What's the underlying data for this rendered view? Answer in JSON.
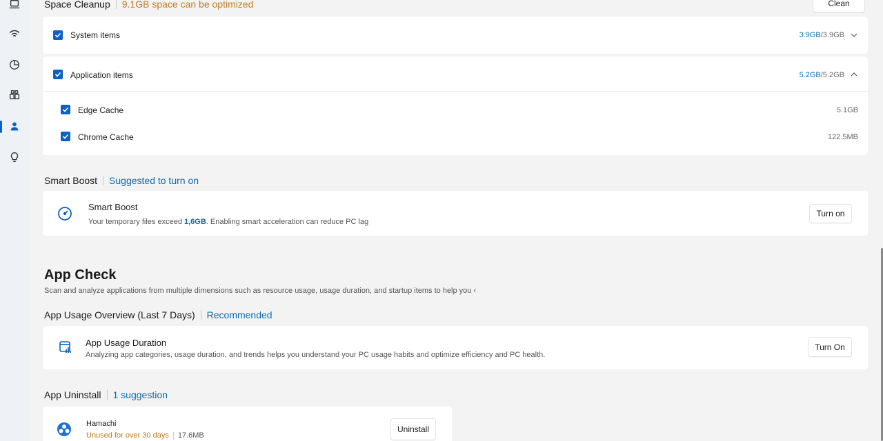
{
  "sidebar": {
    "items": [
      {
        "icon": "laptop-icon"
      },
      {
        "icon": "wifi-icon"
      },
      {
        "icon": "pie-chart-icon"
      },
      {
        "icon": "apps-icon"
      },
      {
        "icon": "cleanup-person-icon",
        "active": true
      },
      {
        "icon": "lightbulb-icon"
      }
    ]
  },
  "space_cleanup": {
    "title": "Space Cleanup",
    "subtitle": "9.1GB space can be optimized",
    "clean_button": "Clean",
    "system_items": {
      "label": "System items",
      "selected": "3.9GB",
      "total": "/3.9GB"
    },
    "application_items": {
      "label": "Application items",
      "selected": "5.2GB",
      "total": "/5.2GB"
    },
    "children": [
      {
        "label": "Edge Cache",
        "size": "5.1GB"
      },
      {
        "label": "Chrome Cache",
        "size": "122.5MB"
      }
    ]
  },
  "smart_boost": {
    "section_title": "Smart Boost",
    "section_hint": "Suggested to turn on",
    "card_title": "Smart Boost",
    "desc_pre": "Your temporary files exceed ",
    "desc_value": "1,6GB",
    "desc_post": ". Enabling smart acceleration can reduce PC lag",
    "button": "Turn on"
  },
  "app_check": {
    "title": "App Check",
    "description": "Scan and analyze applications from multiple dimensions such as resource usage, usage duration, and startup items to help you ‹",
    "usage_overview": {
      "section_title": "App Usage Overview (Last 7 Days)",
      "section_hint": "Recommended",
      "card_title": "App Usage Duration",
      "card_desc": "Analyzing app categories, usage duration, and trends helps you understand your PC usage habits and optimize efficiency and PC health.",
      "button": "Turn On"
    },
    "uninstall": {
      "section_title": "App Uninstall",
      "section_hint": "1 suggestion",
      "app_name": "Hamachi",
      "app_status": "Unused for over 30 days",
      "app_size": "17.6MB",
      "button": "Uninstall"
    }
  },
  "colors": {
    "accent": "#0b62c4",
    "link": "#0b6cb0",
    "warning": "#c07b1a",
    "background": "#f3f3f3",
    "card": "#ffffff"
  }
}
